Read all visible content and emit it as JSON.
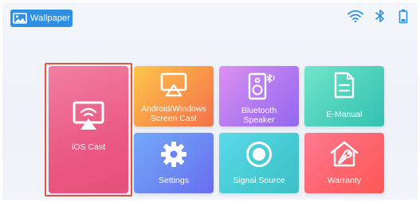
{
  "header": {
    "wallpaper_label": "Wallpaper",
    "status_icons": [
      "wifi-icon",
      "bluetooth-icon",
      "battery-icon"
    ]
  },
  "tiles": [
    {
      "label": "iOS Cast",
      "icon": "airplay-icon",
      "selected": true,
      "colors": [
        "#f0709a",
        "#e84f7a"
      ]
    },
    {
      "label": "Android/Windows\nScreen Cast",
      "icon": "screen-cast-icon",
      "colors": [
        "#fcc14a",
        "#f5734a"
      ]
    },
    {
      "label": "Bluetooth\nSpeaker",
      "icon": "speaker-icon",
      "colors": [
        "#d88af0",
        "#9b6cf0"
      ]
    },
    {
      "label": "E-Manual",
      "icon": "document-icon",
      "colors": [
        "#6ee0c8",
        "#36c4b6"
      ]
    },
    {
      "label": "Settings",
      "icon": "gear-icon",
      "colors": [
        "#6fa0f6",
        "#6a6ff0"
      ]
    },
    {
      "label": "Signal Source",
      "icon": "signal-source-icon",
      "colors": [
        "#57d6e6",
        "#3fc2c8"
      ]
    },
    {
      "label": "Warranty",
      "icon": "house-wrench-icon",
      "colors": [
        "#ff6e8a",
        "#fb5e58"
      ]
    }
  ],
  "colors": {
    "accent": "#2f8fe0",
    "status_icon": "#2f8fe0",
    "focus_border": "#e0563e"
  }
}
